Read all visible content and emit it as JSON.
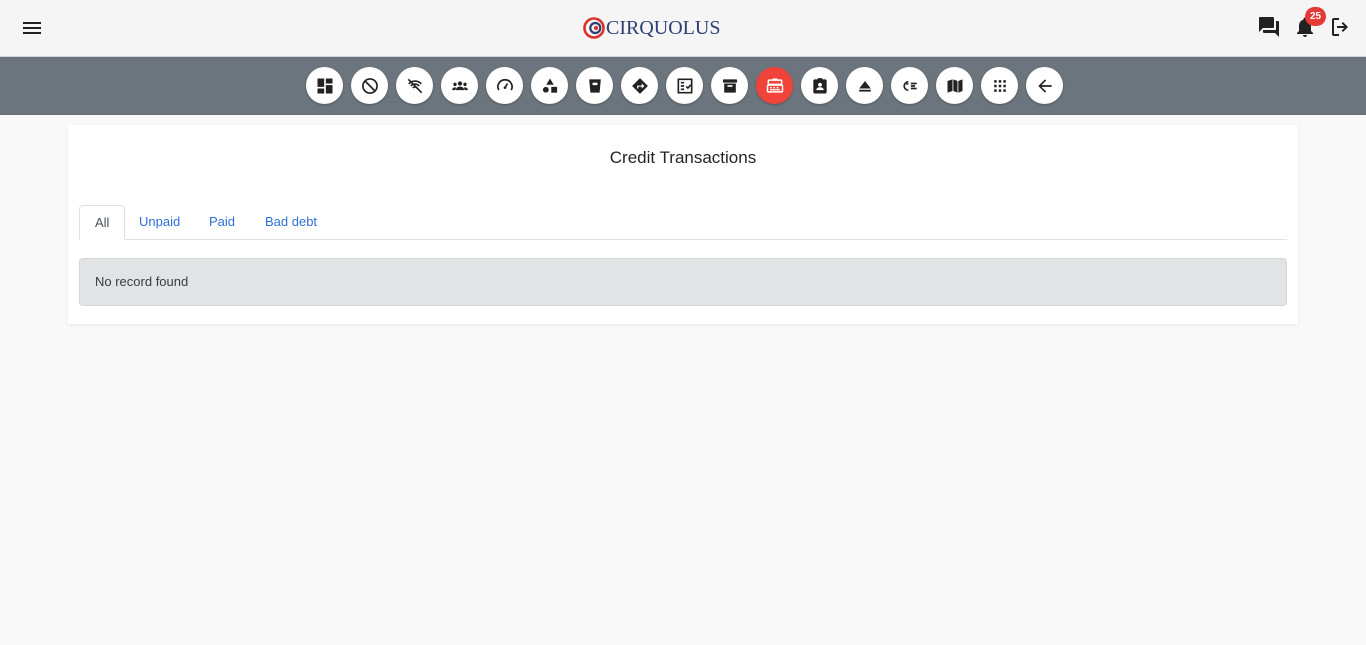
{
  "header": {
    "logo_text": "CIRQUOLUS",
    "notification_count": "25",
    "brand_red": "#e0302b",
    "brand_blue": "#2c3e73"
  },
  "toolbar": {
    "bg_color": "#6c757d",
    "active_color": "#f0443a",
    "buttons": [
      {
        "icon": "dashboard-icon",
        "active": false
      },
      {
        "icon": "blocked-icon",
        "active": false
      },
      {
        "icon": "signal-off-icon",
        "active": false
      },
      {
        "icon": "people-icon",
        "active": false
      },
      {
        "icon": "speedometer-icon",
        "active": false
      },
      {
        "icon": "category-shapes-icon",
        "active": false
      },
      {
        "icon": "delete-bin-icon",
        "active": false
      },
      {
        "icon": "directions-icon",
        "active": false
      },
      {
        "icon": "fact-check-icon",
        "active": false
      },
      {
        "icon": "archive-icon",
        "active": false
      },
      {
        "icon": "cash-register-icon",
        "active": true
      },
      {
        "icon": "assignment-ind-icon",
        "active": false
      },
      {
        "icon": "eject-icon",
        "active": false
      },
      {
        "icon": "checklist-rtl-icon",
        "active": false
      },
      {
        "icon": "book-map-icon",
        "active": false
      },
      {
        "icon": "apps-grid-icon",
        "active": false
      },
      {
        "icon": "arrow-back-icon",
        "active": false
      }
    ]
  },
  "main": {
    "title": "Credit Transactions",
    "tabs": [
      {
        "label": "All",
        "active": true
      },
      {
        "label": "Unpaid",
        "active": false
      },
      {
        "label": "Paid",
        "active": false
      },
      {
        "label": "Bad debt",
        "active": false
      }
    ],
    "empty_message": "No record found"
  }
}
